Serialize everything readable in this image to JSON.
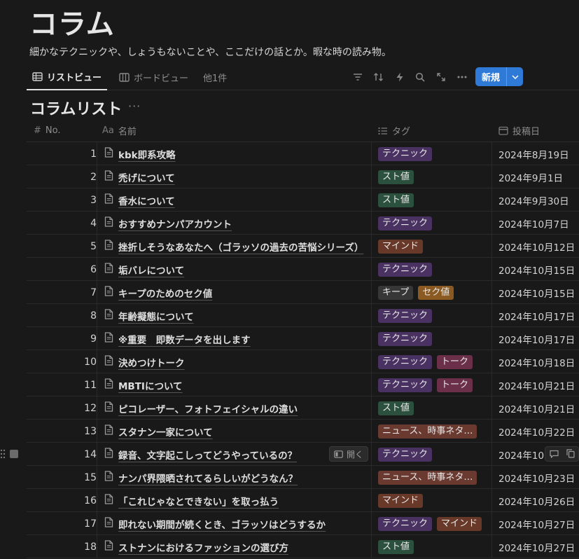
{
  "page": {
    "title": "コラム",
    "description": "細かなテクニックや、しょうもないことや、ここだけの話とか。暇な時の読み物。"
  },
  "views": {
    "tabs": [
      {
        "label": "リストビュー",
        "icon": "table-icon",
        "active": true
      },
      {
        "label": "ボードビュー",
        "icon": "board-icon",
        "active": false
      },
      {
        "label": "他1件",
        "icon": "",
        "active": false
      }
    ],
    "toolbar": [
      "filter-icon",
      "sort-icon",
      "automation-icon",
      "search-icon",
      "expand-icon",
      "more-icon"
    ],
    "new_label": "新規"
  },
  "list": {
    "title": "コラムリスト",
    "more": "···"
  },
  "columns": {
    "no": {
      "label": "No.",
      "icon": "#"
    },
    "name": {
      "label": "名前",
      "icon": "Aa"
    },
    "tags": {
      "label": "タグ",
      "icon": "list-icon"
    },
    "date": {
      "label": "投稿日",
      "icon": "calendar-icon"
    }
  },
  "tag_colors": {
    "テクニック": "#493162",
    "スト値": "#2b513e",
    "マインド": "#683829",
    "キープ": "#373737",
    "セク値": "#8a5a22",
    "トーク": "#6b2f4a",
    "ニュース、時事ネタ…": "#6a3a30"
  },
  "rows": [
    {
      "no": "1",
      "name": "kbk即系攻略",
      "tags": [
        "テクニック"
      ],
      "date": "2024年8月19日"
    },
    {
      "no": "2",
      "name": "禿げについて",
      "tags": [
        "スト値"
      ],
      "date": "2024年9月1日"
    },
    {
      "no": "3",
      "name": "香水について",
      "tags": [
        "スト値"
      ],
      "date": "2024年9月30日"
    },
    {
      "no": "4",
      "name": "おすすめナンパアカウント",
      "tags": [
        "テクニック"
      ],
      "date": "2024年10月7日"
    },
    {
      "no": "5",
      "name": "挫折しそうなあなたへ（ゴラッソの過去の苦悩シリーズ）",
      "tags": [
        "マインド"
      ],
      "date": "2024年10月12日"
    },
    {
      "no": "6",
      "name": "垢バレについて",
      "tags": [
        "テクニック"
      ],
      "date": "2024年10月15日"
    },
    {
      "no": "7",
      "name": "キープのためのセク値",
      "tags": [
        "キープ",
        "セク値"
      ],
      "date": "2024年10月15日"
    },
    {
      "no": "8",
      "name": "年齢擬態について",
      "tags": [
        "テクニック"
      ],
      "date": "2024年10月17日"
    },
    {
      "no": "9",
      "name": "※重要　即数データを出します",
      "tags": [
        "テクニック"
      ],
      "date": "2024年10月17日"
    },
    {
      "no": "10",
      "name": "決めつけトーク",
      "tags": [
        "テクニック",
        "トーク"
      ],
      "date": "2024年10月18日"
    },
    {
      "no": "11",
      "name": "MBTIについて",
      "tags": [
        "テクニック",
        "トーク"
      ],
      "date": "2024年10月21日"
    },
    {
      "no": "12",
      "name": "ピコレーザー、フォトフェイシャルの違い",
      "tags": [
        "スト値"
      ],
      "date": "2024年10月21日"
    },
    {
      "no": "13",
      "name": "スタナン一家について",
      "tags": [
        "ニュース、時事ネタ…"
      ],
      "date": "2024年10月22日"
    },
    {
      "no": "14",
      "name": "録音、文字起こしってどうやっているの？",
      "tags": [
        "テクニック"
      ],
      "date": "2024年10",
      "hover": true
    },
    {
      "no": "15",
      "name": "ナンパ界隈晒されてるらしいがどうなん？",
      "tags": [
        "ニュース、時事ネタ…"
      ],
      "date": "2024年10月23日"
    },
    {
      "no": "16",
      "name": "「これじゃなとできない」を取っ払う",
      "tags": [
        "マインド"
      ],
      "date": "2024年10月26日"
    },
    {
      "no": "17",
      "name": "即れない期間が続くとき、ゴラッソはどうするか",
      "tags": [
        "テクニック",
        "マインド"
      ],
      "date": "2024年10月27日"
    },
    {
      "no": "18",
      "name": "ストナンにおけるファッションの選び方",
      "tags": [
        "スト値"
      ],
      "date": "2024年10月27日"
    }
  ],
  "hover_row": {
    "open_label": "開く"
  }
}
